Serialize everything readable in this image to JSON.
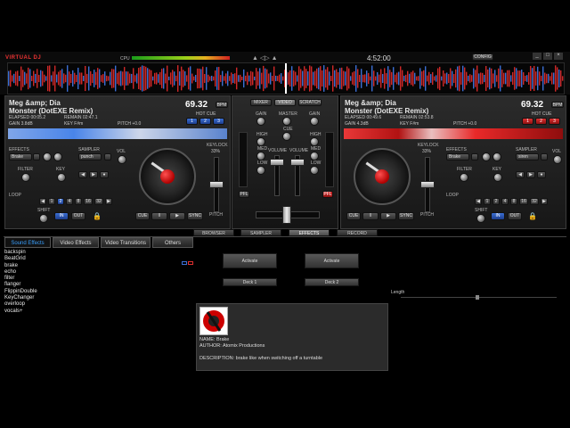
{
  "colors": {
    "accent": "#3b6fd4",
    "alert": "#e03030",
    "background": "#000000",
    "panel": "#1e1e1e"
  },
  "topbar": {
    "logo": "VIRTUAL DJ",
    "cpu_label": "CPU",
    "clock": "4:52:00",
    "config_label": "CONFIG"
  },
  "center_mixer": {
    "mode_buttons": [
      "MIXER",
      "VIDEO",
      "SCRATCH"
    ],
    "labels": {
      "gain_left": "GAIN",
      "gain_right": "GAIN",
      "master": "MASTER",
      "cue": "CUE",
      "high_left": "HIGH",
      "high_right": "HIGH",
      "med_left": "MED",
      "med_right": "MED",
      "low_left": "LOW",
      "low_right": "LOW",
      "volume_left": "VOLUME",
      "volume_right": "VOLUME",
      "pfl_left": "PFL",
      "pfl_right": "PFL"
    }
  },
  "deck1": {
    "artist": "Meg &amp; Dia",
    "title": "Monster (DotEXE Remix)",
    "elapsed": "ELAPSED 00:05.2",
    "remain": "REMAIN 02:47.1",
    "gain": "GAIN 3.8dB",
    "key": "KEY F#m",
    "pitch": "PITCH +0.0",
    "bpm": "69.32",
    "bpm_badge": "BPM",
    "hotcue_label": "HOT CUE",
    "hotcues": [
      "1",
      "2",
      "3"
    ],
    "effects_label": "EFFECTS",
    "effect_value": "Brake",
    "sampler_label": "SAMPLER",
    "sampler_value": "punch",
    "vol_label": "VOL",
    "filter_label": "FILTER",
    "key_knob_label": "KEY",
    "loop_label": "LOOP",
    "loop_values": [
      "1",
      "2",
      "4",
      "8",
      "16",
      "32"
    ],
    "shift_label": "SHIFT",
    "in_label": "IN",
    "out_label": "OUT",
    "transport": [
      "CUE",
      "‖",
      "▶",
      "SYNC"
    ],
    "keylock_label": "KEYLOCK",
    "keylock_value": "33%",
    "pitch_label": "PITCH"
  },
  "deck2": {
    "artist": "Meg &amp; Dia",
    "title": "Monster (DotEXE Remix)",
    "elapsed": "ELAPSED 00:49.6",
    "remain": "REMAIN 02:53.8",
    "gain": "GAIN 4.3dB",
    "key": "KEY F#m",
    "pitch": "PITCH +0.0",
    "bpm": "69.32",
    "bpm_badge": "BPM",
    "hotcue_label": "HOT CUE",
    "hotcues": [
      "1",
      "2",
      "3"
    ],
    "effects_label": "EFFECTS",
    "effect_value": "Brake",
    "sampler_label": "SAMPLER",
    "sampler_value": "siren",
    "vol_label": "VOL",
    "filter_label": "FILTER",
    "key_knob_label": "KEY",
    "loop_label": "LOOP",
    "loop_values": [
      "1",
      "2",
      "4",
      "8",
      "16",
      "32"
    ],
    "shift_label": "SHIFT",
    "in_label": "IN",
    "out_label": "OUT",
    "transport": [
      "CUE",
      "‖",
      "▶",
      "SYNC"
    ],
    "keylock_label": "KEYLOCK",
    "keylock_value": "33%",
    "pitch_label": "PITCH"
  },
  "bottom_tabs": [
    "BROWSER",
    "SAMPLER",
    "EFFECTS",
    "RECORD"
  ],
  "effects_panel": {
    "subtabs": [
      "Sound Effects",
      "Video Effects",
      "Video Transitions",
      "Others"
    ],
    "effects_list": [
      "backspin",
      "BeatGrid",
      "brake",
      "echo",
      "filter",
      "flanger",
      "FlippinDouble",
      "KeyChanger",
      "overloop",
      "vocals+"
    ],
    "activate_label": "Activate",
    "deck1_label": "Deck 1",
    "deck2_label": "Deck 2",
    "length_label": "Length",
    "info": {
      "name": "NAME: Brake",
      "author": "AUTHOR: Atomix Productions",
      "description": "DESCRIPTION: brake like when switching off a turntable"
    }
  }
}
